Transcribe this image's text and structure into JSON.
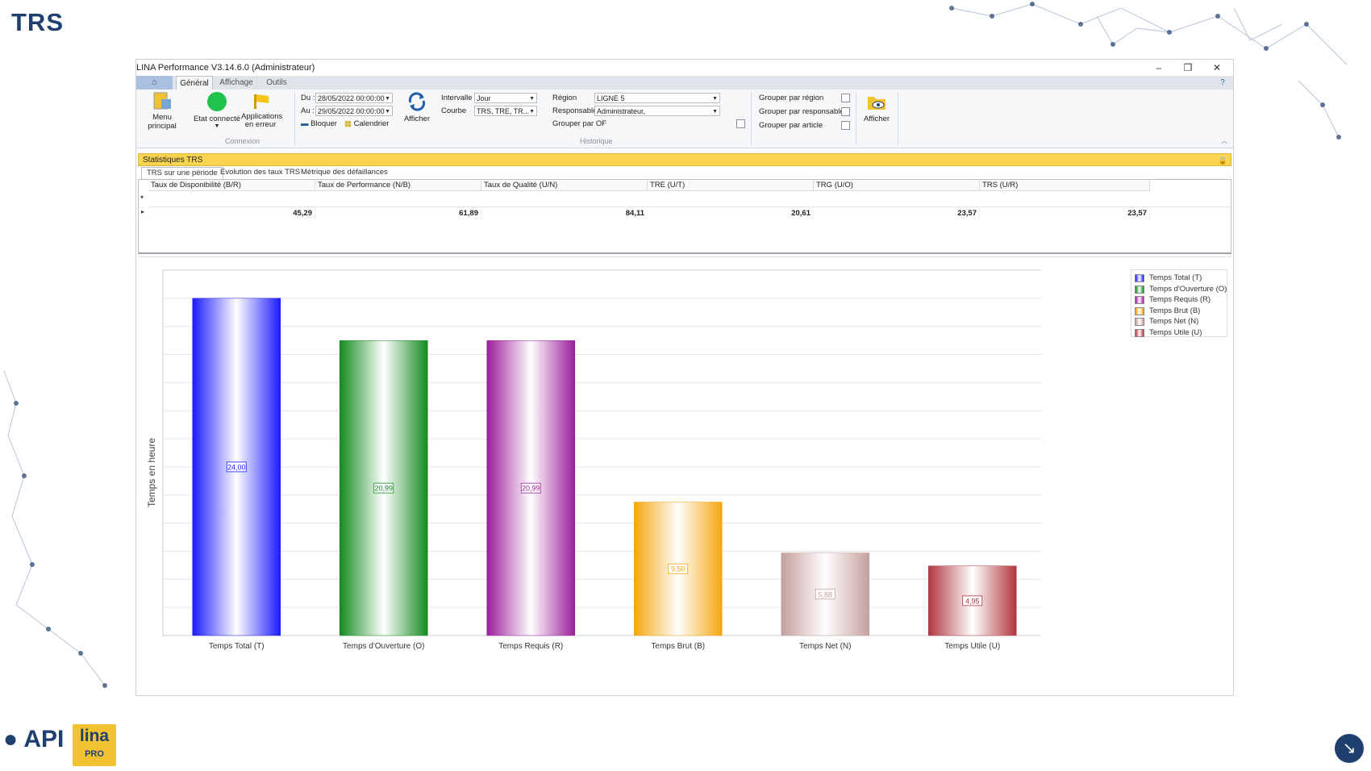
{
  "slide": {
    "title": "TRS"
  },
  "window": {
    "title": "LINA Performance  V3.14.6.0  (Administrateur)",
    "controls": {
      "minimize": "–",
      "restore": "❐",
      "close": "✕"
    },
    "help_glyph": "?"
  },
  "tabs": [
    {
      "label": "Général",
      "active": true
    },
    {
      "label": "Affichage",
      "active": false
    },
    {
      "label": "Outils",
      "active": false
    }
  ],
  "ribbon": {
    "menu_principal": "Menu principal",
    "etat_connecte": "Etat connecté",
    "applications_en_erreur": "Applications en erreur",
    "group_connexion": "Connexion",
    "du_label": "Du :",
    "du_value": "28/05/2022 00:00:00",
    "au_label": "Au :",
    "au_value": "29/05/2022 00:00:00",
    "bloquer": "Bloquer",
    "calendrier": "Calendrier",
    "afficher": "Afficher",
    "intervalle_label": "Intervalle",
    "intervalle_value": "Jour",
    "courbe_label": "Courbe",
    "courbe_value": "TRS, TRE, TR...",
    "region_label": "Région",
    "region_value": "LIGNE 5",
    "responsable_label": "Responsable",
    "responsable_value": "Administrateur,",
    "grouper_of": "Grouper par OF",
    "group_historique": "Historique",
    "grouper_region": "Grouper par région",
    "grouper_responsable": "Grouper par responsable",
    "grouper_article": "Grouper par article",
    "afficher2": "Afficher"
  },
  "panel": {
    "title": "Statistiques TRS",
    "subtabs": [
      "TRS sur une période",
      "Evolution des taux TRS",
      "Métrique des défaillances"
    ]
  },
  "grid": {
    "headers": [
      "Taux de Disponibilité (B/R)",
      "Taux de Performance (N/B)",
      "Taux de Qualité (U/N)",
      "TRE (U/T)",
      "TRG (U/O)",
      "TRS (U/R)"
    ],
    "values": [
      "45,29",
      "61,89",
      "84,11",
      "20,61",
      "23,57",
      "23,57"
    ]
  },
  "chart_data": {
    "type": "bar",
    "categories": [
      "Temps Total (T)",
      "Temps d'Ouverture (O)",
      "Temps Requis (R)",
      "Temps Brut (B)",
      "Temps Net (N)",
      "Temps Utile (U)"
    ],
    "values": [
      24.0,
      20.99,
      20.99,
      9.5,
      5.88,
      4.95
    ],
    "value_labels": [
      "24,00",
      "20,99",
      "20,99",
      "9,50",
      "5,88",
      "4,95"
    ],
    "colors": [
      "#1a1aff",
      "#138a1f",
      "#9b1d9b",
      "#f5a50f",
      "#c4a09e",
      "#b0363d"
    ],
    "ylabel": "Temps en heure",
    "ylim": [
      0,
      26
    ],
    "legend_position": "top-right"
  }
}
